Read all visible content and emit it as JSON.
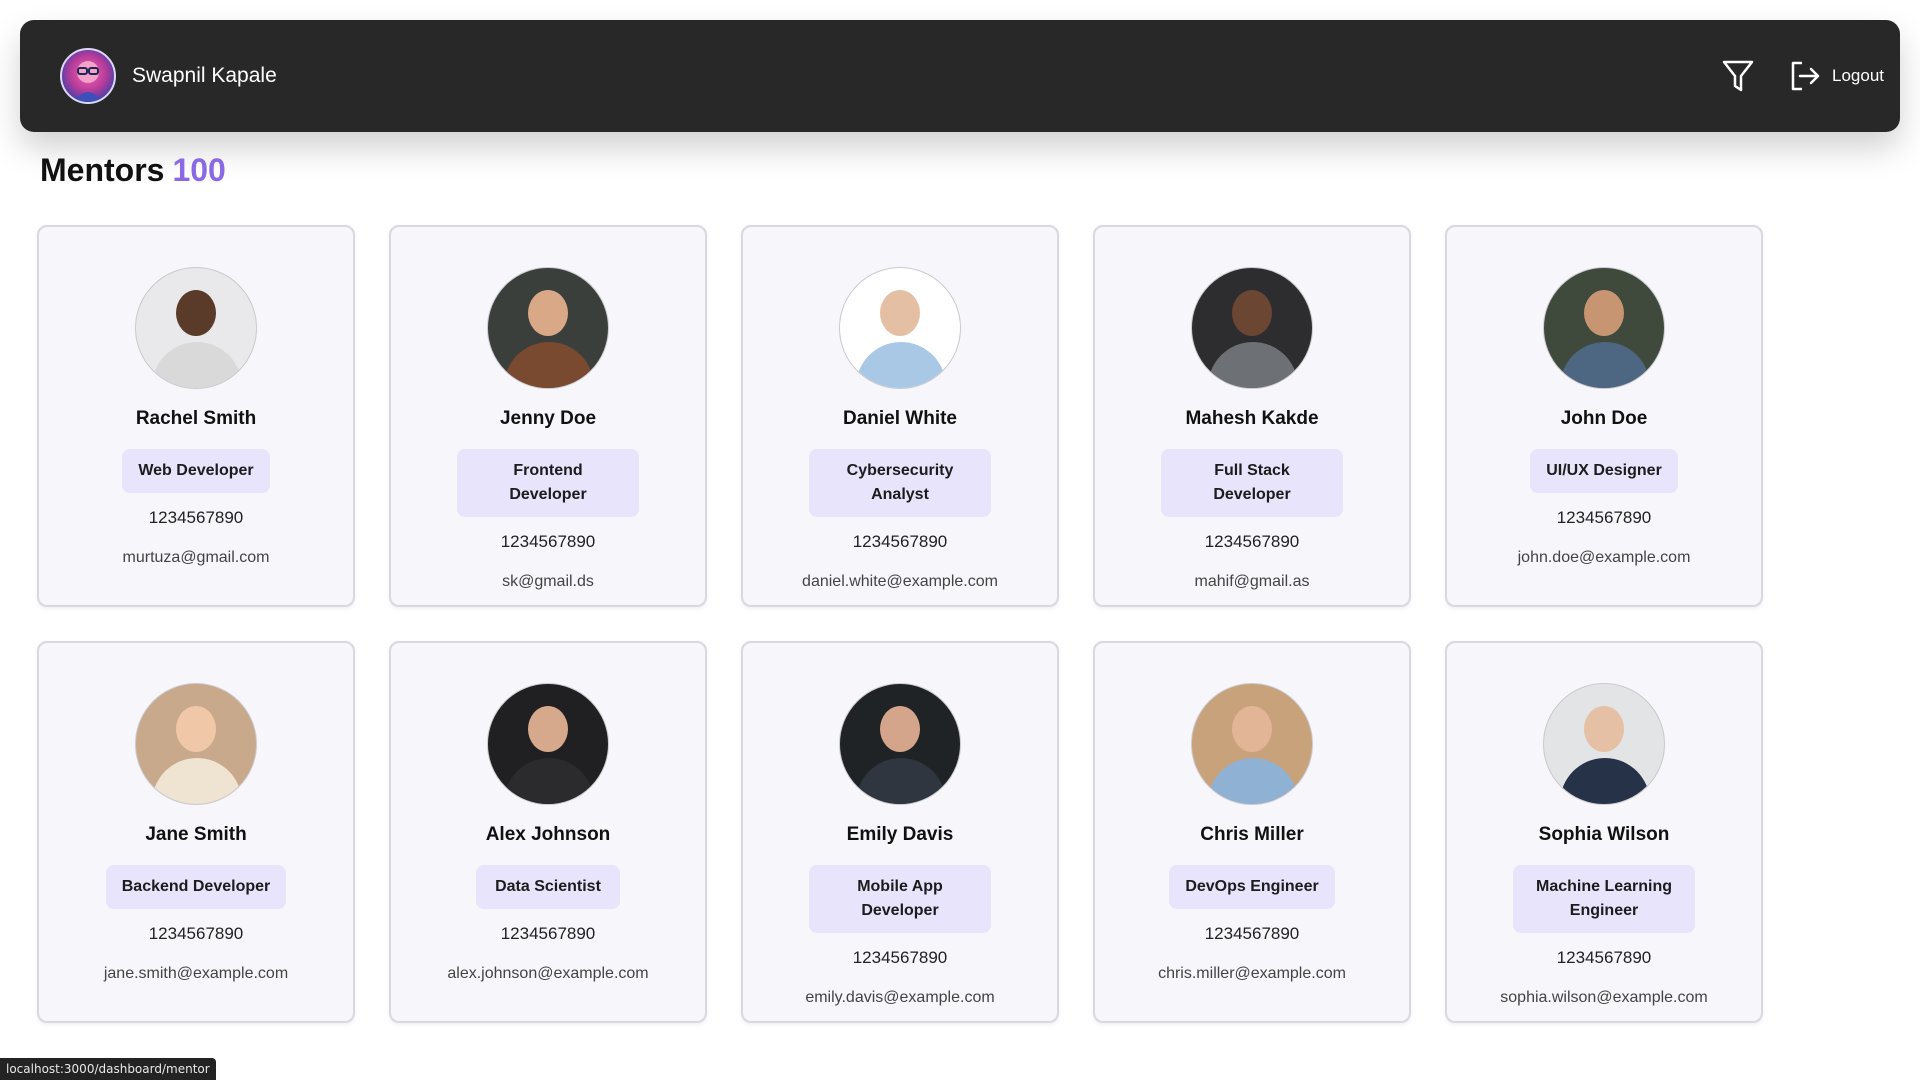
{
  "user": {
    "name": "Swapnil Kapale"
  },
  "header": {
    "logout_label": "Logout"
  },
  "title": {
    "label": "Mentors",
    "count": "100"
  },
  "mentors": [
    {
      "name": "Rachel Smith",
      "role": "Web Developer",
      "phone": "1234567890",
      "email": "murtuza@gmail.com"
    },
    {
      "name": "Jenny Doe",
      "role": "Frontend Developer",
      "phone": "1234567890",
      "email": "sk@gmail.ds"
    },
    {
      "name": "Daniel White",
      "role": "Cybersecurity Analyst",
      "phone": "1234567890",
      "email": "daniel.white@example.com"
    },
    {
      "name": "Mahesh Kakde",
      "role": "Full Stack Developer",
      "phone": "1234567890",
      "email": "mahif@gmail.as"
    },
    {
      "name": "John Doe",
      "role": "UI/UX Designer",
      "phone": "1234567890",
      "email": "john.doe@example.com"
    },
    {
      "name": "Jane Smith",
      "role": "Backend Developer",
      "phone": "1234567890",
      "email": "jane.smith@example.com"
    },
    {
      "name": "Alex Johnson",
      "role": "Data Scientist",
      "phone": "1234567890",
      "email": "alex.johnson@example.com"
    },
    {
      "name": "Emily Davis",
      "role": "Mobile App Developer",
      "phone": "1234567890",
      "email": "emily.davis@example.com"
    },
    {
      "name": "Chris Miller",
      "role": "DevOps Engineer",
      "phone": "1234567890",
      "email": "chris.miller@example.com"
    },
    {
      "name": "Sophia Wilson",
      "role": "Machine Learning Engineer",
      "phone": "1234567890",
      "email": "sophia.wilson@example.com"
    }
  ],
  "status_bar": {
    "url": "localhost:3000/dashboard/mentor"
  },
  "colors": {
    "accent": "#8b68e6",
    "navbar": "#282828",
    "badge": "#e7e4fb",
    "card": "#f6f6fb"
  },
  "icons": {
    "filter": "funnel-icon",
    "logout": "logout-arrow-icon"
  }
}
